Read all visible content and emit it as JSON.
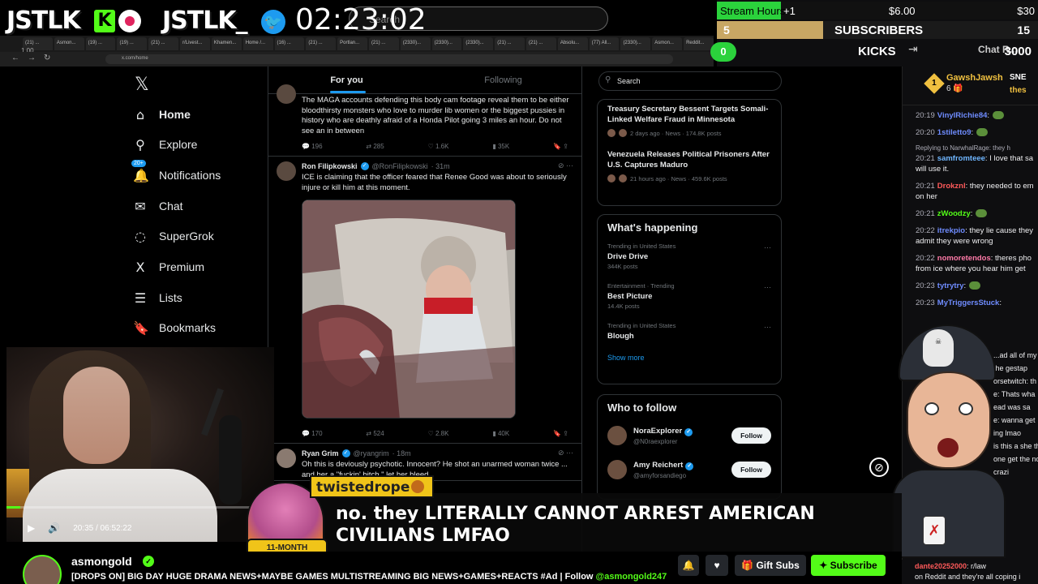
{
  "overlay": {
    "logo1": "JSTLK",
    "logo_k": "K",
    "logo2": "JSTLK_",
    "timer": "02:23:02",
    "browser_search_placeholder": "Search",
    "zoom": "1.00",
    "tabs": [
      "(21) ...",
      "Asmon...",
      "(19) ...",
      "(19) ...",
      "(21) ...",
      "r/Livest...",
      "Khamen...",
      "Home /...",
      "(16) ...",
      "(21) ...",
      "Portlan...",
      "(21) ...",
      "(2330)...",
      "(2330)...",
      "(2330)...",
      "(21) ...",
      "(21) ...",
      "Absolu...",
      "(77) All...",
      "(2330)...",
      "Asmon...",
      "Reddit..."
    ],
    "address": "x.com/home"
  },
  "stats": {
    "stream_hours_label": "Stream Hours",
    "stream_hours_increment": "+1",
    "amount_current": "$6.00",
    "amount_target": "$30",
    "stream_hours_progress": 0.2,
    "subs_current": "5",
    "subs_label": "SUBSCRIBERS",
    "subs_target": "15",
    "subs_progress": 0.33,
    "kicks_current": "0",
    "kicks_label": "KICKS",
    "kicks_target": "3000",
    "chat_room_label": "Chat R..."
  },
  "x_nav": {
    "items": [
      {
        "icon": "home-icon",
        "glyph": "⌂",
        "label": "Home"
      },
      {
        "icon": "explore-icon",
        "glyph": "⚲",
        "label": "Explore"
      },
      {
        "icon": "bell-icon",
        "glyph": "🔔",
        "label": "Notifications",
        "badge": "20+"
      },
      {
        "icon": "mail-icon",
        "glyph": "✉",
        "label": "Chat"
      },
      {
        "icon": "grok-icon",
        "glyph": "◌",
        "label": "SuperGrok"
      },
      {
        "icon": "x-icon",
        "glyph": "X",
        "label": "Premium"
      },
      {
        "icon": "list-icon",
        "glyph": "☰",
        "label": "Lists"
      },
      {
        "icon": "bookmark-icon",
        "glyph": "🔖",
        "label": "Bookmarks"
      }
    ]
  },
  "feed": {
    "tab_for_you": "For you",
    "tab_following": "Following",
    "tweet1": {
      "text": "The MAGA accounts defending this body cam footage reveal them to be either bloodthirsty monsters who love to murder lib women or the biggest pussies in history who are deathly afraid of a Honda Pilot going 3 miles an hour.  Do not see an in between",
      "replies": "196",
      "reposts": "285",
      "likes": "1.6K",
      "views": "35K"
    },
    "tweet2": {
      "name": "Ron Filipkowski",
      "handle": "@RonFilipkowski",
      "time": "· 31m",
      "text": "ICE is claiming that the officer feared that Renee Good was about to seriously injure or kill him at this moment.",
      "replies": "170",
      "reposts": "524",
      "likes": "2.8K",
      "views": "40K"
    },
    "tweet3": {
      "name": "Ryan Grim",
      "handle": "@ryangrim",
      "time": "· 18m",
      "text": "Oh this is deviously psychotic. Innocent? He shot an unarmed woman twice ... and her a \"fuckin' bitch,\" let her bleed"
    }
  },
  "right_col": {
    "search_placeholder": "Search",
    "news": [
      {
        "title": "Treasury Secretary Bessent Targets Somali-Linked Welfare Fraud in Minnesota",
        "meta": "2 days ago · News · 174.8K posts"
      },
      {
        "title": "Venezuela Releases Political Prisoners After U.S. Captures Maduro",
        "meta": "21 hours ago · News · 459.6K posts"
      }
    ],
    "happening_title": "What's happening",
    "trends": [
      {
        "context": "Trending in United States",
        "name": "Drive Drive",
        "count": "344K posts"
      },
      {
        "context": "Entertainment · Trending",
        "name": "Best Picture",
        "count": "14.4K posts"
      },
      {
        "context": "Trending in United States",
        "name": "Blough",
        "count": ""
      }
    ],
    "show_more": "Show more",
    "follow_title": "Who to follow",
    "follows": [
      {
        "name": "NoraExplorer",
        "handle": "@N0raexplorer",
        "button": "Follow"
      },
      {
        "name": "Amy Reichert",
        "handle": "@amyforsandiego",
        "button": "Follow"
      }
    ]
  },
  "player": {
    "time": "20:35 / 06:52:22",
    "progress": 0.05
  },
  "chat": {
    "gifter_rank": "1",
    "gifter_name": "GawshJawsh",
    "gifter_count": "6",
    "pinned_1": "SNE",
    "pinned_2": "thes",
    "messages": [
      {
        "time": "20:19",
        "user": "VinylRichie84",
        "color": "#6f8cff",
        "text": ":",
        "emote": true
      },
      {
        "time": "20:20",
        "user": "1stiletto9",
        "color": "#6f8cff",
        "text": ":",
        "emote": true
      },
      {
        "reply": "Replying to NarwhalRage: they h"
      },
      {
        "time": "20:21",
        "user": "samfromteee",
        "color": "#6fb6ff",
        "text": ": I love that sa",
        "text2": "will use it."
      },
      {
        "time": "20:21",
        "user": "Drokznl",
        "color": "#ff5a5a",
        "text": ": they needed to em",
        "text2": "on her"
      },
      {
        "time": "20:21",
        "user": "zWoodzy",
        "color": "#53fc18",
        "text": ":",
        "emote": true
      },
      {
        "time": "20:22",
        "user": "itrekpio",
        "color": "#6f8cff",
        "text": ": they lie cause they",
        "text2": "admit they were wrong"
      },
      {
        "time": "20:22",
        "user": "nomoretendos",
        "color": "#ff7aa8",
        "text": ": theres pho",
        "text2": "from ice where you hear him get"
      },
      {
        "time": "20:23",
        "user": "tytrytry",
        "color": "#6f8cff",
        "text": ":",
        "emote": true
      },
      {
        "time": "20:23",
        "user": "MyTriggersStuck",
        "color": "#6f8cff",
        "text": ":"
      }
    ],
    "partial_lines": [
      "...ad all of my",
      "the gestap",
      "orsetwitch: th",
      "e: Thats wha",
      "ead was sa",
      "e: wanna get",
      "ing lmao",
      "is this a she th",
      "one get the no",
      "crazi"
    ],
    "bottom_user": "dante20252000",
    "bottom_text": ": r/law",
    "bottom_text2": "on Reddit and they're all coping i"
  },
  "alert": {
    "username": "twistedrope",
    "months": "11-MONTH SUBSCRIBER",
    "message": "no. they LITERALLY CANNOT ARREST AMERICAN CIVILIANS LMFAO"
  },
  "streamer": {
    "name": "asmongold",
    "title_prefix": "[DROPS ON] BIG DAY HUGE DRAMA NEWS+MAYBE GAMES MULTISTREAMING BIG NEWS+GAMES+REACTS #Ad | Follow ",
    "title_handle": "@asmongold247",
    "gift_subs": "Gift Subs",
    "subscribe": "Subscribe"
  }
}
